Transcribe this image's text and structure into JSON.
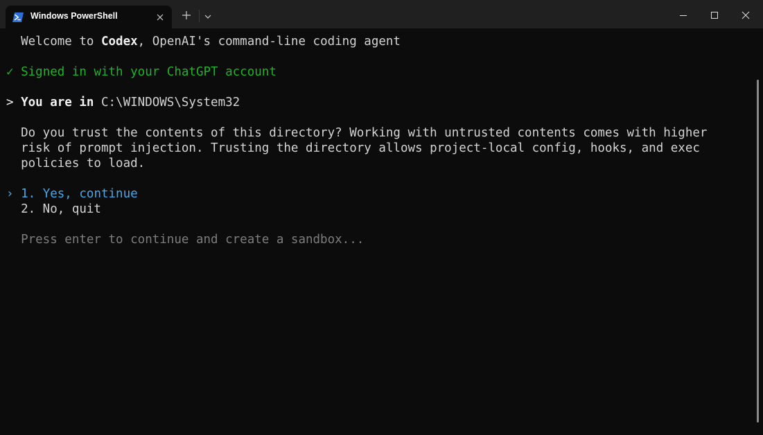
{
  "window": {
    "tab_title": "Windows PowerShell"
  },
  "terminal": {
    "welcome_prefix": "Welcome to ",
    "welcome_app": "Codex",
    "welcome_suffix": ", OpenAI's command-line coding agent",
    "signed_in_mark": "✓",
    "signed_in_text": "Signed in with your ChatGPT account",
    "location_prompt": ">",
    "location_label": "You are in",
    "location_path": " C:\\WINDOWS\\System32",
    "trust_question": [
      "Do you trust the contents of this directory? Working with untrusted contents comes with higher",
      "risk of prompt injection. Trusting the directory allows project-local config, hooks, and exec",
      "policies to load."
    ],
    "selection_marker": "›",
    "options": [
      "1. Yes, continue",
      "2. No, quit"
    ],
    "hint": "Press enter to continue and create a sandbox..."
  },
  "colors": {
    "background": "#0c0c0c",
    "titlebar": "#202020",
    "success": "#1fb32a",
    "selected": "#4aa8e6",
    "hint": "#7d7d7d"
  }
}
